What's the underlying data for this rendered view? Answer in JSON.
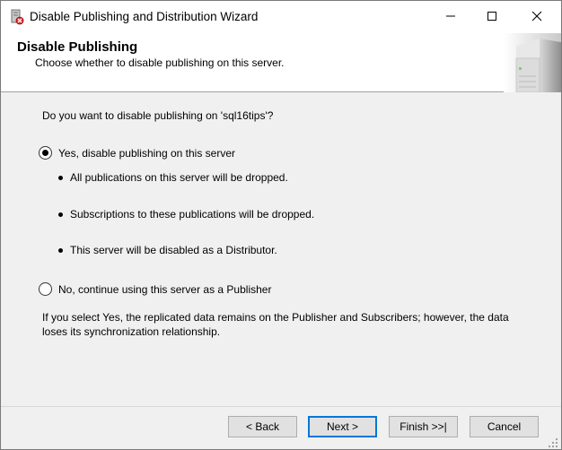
{
  "window": {
    "title": "Disable Publishing and Distribution Wizard",
    "icons": {
      "app": "wizard-server-icon",
      "minimize": "minimize-icon",
      "maximize": "maximize-icon",
      "close": "close-icon"
    }
  },
  "header": {
    "title": "Disable Publishing",
    "subtitle": "Choose whether to disable publishing on this server.",
    "graphic": "server-graphic-icon"
  },
  "content": {
    "question": "Do you want to disable publishing on 'sql16tips'?",
    "option_yes": {
      "label": "Yes, disable publishing on this server",
      "checked": true,
      "bullets": [
        "All publications on this server will be dropped.",
        "Subscriptions to these publications will be dropped.",
        "This server will be disabled as a Distributor."
      ]
    },
    "option_no": {
      "label": "No, continue using this server as a Publisher",
      "checked": false
    },
    "note": "If you select Yes, the replicated data remains on the Publisher and Subscribers; however, the data loses its synchronization relationship."
  },
  "footer": {
    "back_label": "< Back",
    "next_label": "Next >",
    "finish_label": "Finish >>|",
    "cancel_label": "Cancel"
  },
  "colors": {
    "window_bg": "#f0f0f0",
    "header_bg": "#ffffff",
    "default_button_border": "#0078d7"
  }
}
